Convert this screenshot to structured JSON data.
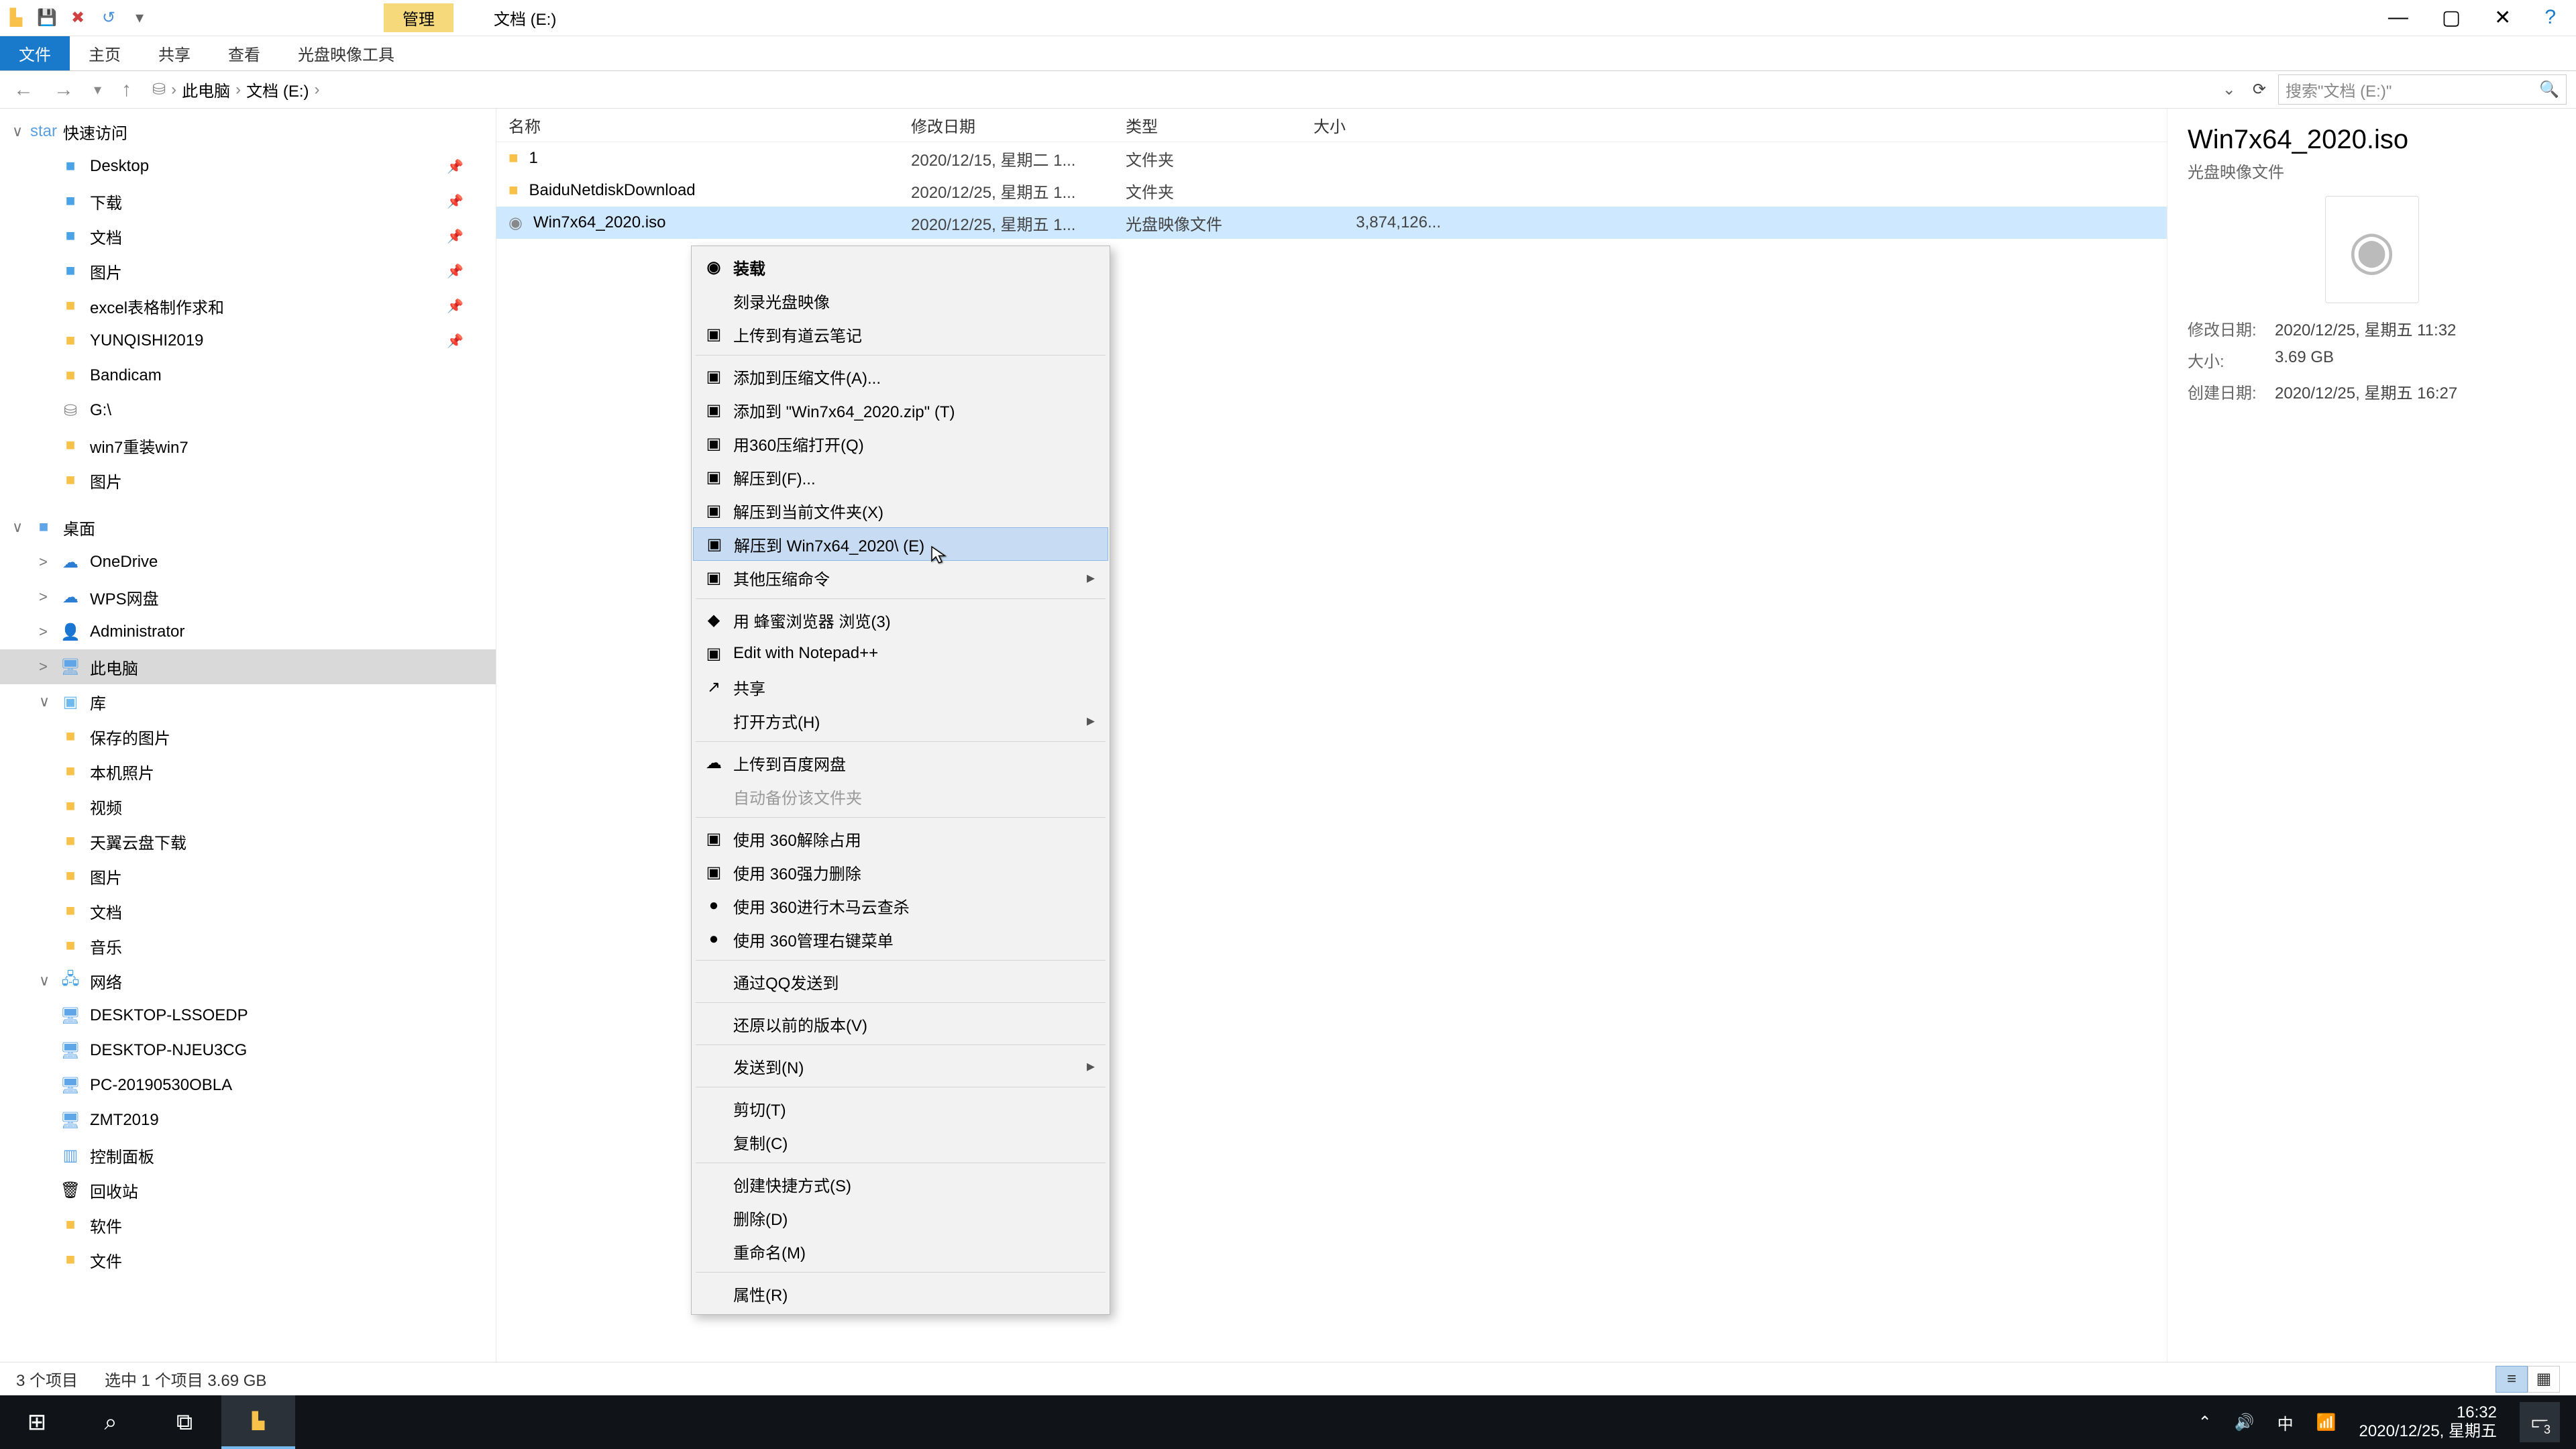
{
  "qat_icons": [
    "folder",
    "disk",
    "delete",
    "undo",
    "dropdown"
  ],
  "context_tab": "管理",
  "window_title": "文档 (E:)",
  "ribbon": {
    "file": "文件",
    "tabs": [
      "主页",
      "共享",
      "查看",
      "光盘映像工具"
    ]
  },
  "nav_buttons": {
    "back": "←",
    "fwd": "→",
    "up": "↑"
  },
  "breadcrumb": [
    "此电脑",
    "文档 (E:)"
  ],
  "search_placeholder": "搜索\"文档 (E:)\"",
  "columns": {
    "name": "名称",
    "date": "修改日期",
    "type": "类型",
    "size": "大小"
  },
  "tree": [
    {
      "label": "快速访问",
      "depth": 1,
      "icon": "star",
      "color": "star",
      "chev": "∨"
    },
    {
      "label": "Desktop",
      "depth": 2,
      "icon": "■",
      "color": "folder-b",
      "pin": true
    },
    {
      "label": "下载",
      "depth": 2,
      "icon": "■",
      "color": "folder-b",
      "pin": true
    },
    {
      "label": "文档",
      "depth": 2,
      "icon": "■",
      "color": "folder-b",
      "pin": true
    },
    {
      "label": "图片",
      "depth": 2,
      "icon": "■",
      "color": "folder-b",
      "pin": true
    },
    {
      "label": "excel表格制作求和",
      "depth": 2,
      "icon": "■",
      "color": "folder-y",
      "pin": true
    },
    {
      "label": "YUNQISHI2019",
      "depth": 2,
      "icon": "■",
      "color": "folder-y",
      "pin": true
    },
    {
      "label": "Bandicam",
      "depth": 2,
      "icon": "■",
      "color": "folder-y"
    },
    {
      "label": "G:\\",
      "depth": 2,
      "icon": "⛁",
      "color": "disk"
    },
    {
      "label": "win7重装win7",
      "depth": 2,
      "icon": "■",
      "color": "folder-y"
    },
    {
      "label": "图片",
      "depth": 2,
      "icon": "■",
      "color": "folder-y"
    },
    {
      "label": "桌面",
      "depth": 1,
      "icon": "■",
      "color": "mon",
      "chev": "∨",
      "spacer": true
    },
    {
      "label": "OneDrive",
      "depth": 2,
      "icon": "☁",
      "color": "cloud",
      "chev": ">"
    },
    {
      "label": "WPS网盘",
      "depth": 2,
      "icon": "☁",
      "color": "cloud",
      "chev": ">"
    },
    {
      "label": "Administrator",
      "depth": 2,
      "icon": "👤",
      "color": "",
      "chev": ">"
    },
    {
      "label": "此电脑",
      "depth": 2,
      "icon": "🖥",
      "color": "mon",
      "chev": ">",
      "sel": true
    },
    {
      "label": "库",
      "depth": 2,
      "icon": "▣",
      "color": "lib",
      "chev": "∨"
    },
    {
      "label": "保存的图片",
      "depth": 3,
      "icon": "■",
      "color": "folder-y"
    },
    {
      "label": "本机照片",
      "depth": 3,
      "icon": "■",
      "color": "folder-y"
    },
    {
      "label": "视频",
      "depth": 3,
      "icon": "■",
      "color": "folder-y"
    },
    {
      "label": "天翼云盘下载",
      "depth": 3,
      "icon": "■",
      "color": "folder-y"
    },
    {
      "label": "图片",
      "depth": 3,
      "icon": "■",
      "color": "folder-y"
    },
    {
      "label": "文档",
      "depth": 3,
      "icon": "■",
      "color": "folder-y"
    },
    {
      "label": "音乐",
      "depth": 3,
      "icon": "■",
      "color": "folder-y"
    },
    {
      "label": "网络",
      "depth": 2,
      "icon": "🖧",
      "color": "net",
      "chev": "∨"
    },
    {
      "label": "DESKTOP-LSSOEDP",
      "depth": 3,
      "icon": "🖥",
      "color": "mon"
    },
    {
      "label": "DESKTOP-NJEU3CG",
      "depth": 3,
      "icon": "🖥",
      "color": "mon"
    },
    {
      "label": "PC-20190530OBLA",
      "depth": 3,
      "icon": "🖥",
      "color": "mon"
    },
    {
      "label": "ZMT2019",
      "depth": 3,
      "icon": "🖥",
      "color": "mon"
    },
    {
      "label": "控制面板",
      "depth": 2,
      "icon": "▥",
      "color": "mon"
    },
    {
      "label": "回收站",
      "depth": 2,
      "icon": "🗑",
      "color": ""
    },
    {
      "label": "软件",
      "depth": 2,
      "icon": "■",
      "color": "folder-y"
    },
    {
      "label": "文件",
      "depth": 2,
      "icon": "■",
      "color": "folder-y"
    }
  ],
  "rows": [
    {
      "name": "1",
      "date": "2020/12/15, 星期二 1...",
      "type": "文件夹",
      "size": "",
      "icon": "■",
      "color": "folder-y"
    },
    {
      "name": "BaiduNetdiskDownload",
      "date": "2020/12/25, 星期五 1...",
      "type": "文件夹",
      "size": "",
      "icon": "■",
      "color": "folder-y"
    },
    {
      "name": "Win7x64_2020.iso",
      "date": "2020/12/25, 星期五 1...",
      "type": "光盘映像文件",
      "size": "3,874,126...",
      "icon": "◉",
      "color": "disk",
      "sel": true
    }
  ],
  "details": {
    "title": "Win7x64_2020.iso",
    "subtitle": "光盘映像文件",
    "meta": [
      {
        "k": "修改日期:",
        "v": "2020/12/25, 星期五 11:32"
      },
      {
        "k": "大小:",
        "v": "3.69 GB"
      },
      {
        "k": "创建日期:",
        "v": "2020/12/25, 星期五 16:27"
      }
    ]
  },
  "context_menu": [
    {
      "label": "装载",
      "icon": "◉",
      "bold": true
    },
    {
      "label": "刻录光盘映像"
    },
    {
      "label": "上传到有道云笔记",
      "icon": "▣"
    },
    {
      "sep": true
    },
    {
      "label": "添加到压缩文件(A)...",
      "icon": "▣"
    },
    {
      "label": "添加到 \"Win7x64_2020.zip\" (T)",
      "icon": "▣"
    },
    {
      "label": "用360压缩打开(Q)",
      "icon": "▣"
    },
    {
      "label": "解压到(F)...",
      "icon": "▣"
    },
    {
      "label": "解压到当前文件夹(X)",
      "icon": "▣"
    },
    {
      "label": "解压到 Win7x64_2020\\ (E)",
      "icon": "▣",
      "hov": true
    },
    {
      "label": "其他压缩命令",
      "icon": "▣",
      "sub": true
    },
    {
      "sep": true
    },
    {
      "label": "用 蜂蜜浏览器 浏览(3)",
      "icon": "◆"
    },
    {
      "label": "Edit with Notepad++",
      "icon": "▣"
    },
    {
      "label": "共享",
      "icon": "↗"
    },
    {
      "label": "打开方式(H)",
      "sub": true
    },
    {
      "sep": true
    },
    {
      "label": "上传到百度网盘",
      "icon": "☁"
    },
    {
      "label": "自动备份该文件夹",
      "dis": true
    },
    {
      "sep": true
    },
    {
      "label": "使用 360解除占用",
      "icon": "▣"
    },
    {
      "label": "使用 360强力删除",
      "icon": "▣"
    },
    {
      "label": "使用 360进行木马云查杀",
      "icon": "●"
    },
    {
      "label": "使用 360管理右键菜单",
      "icon": "●"
    },
    {
      "sep": true
    },
    {
      "label": "通过QQ发送到"
    },
    {
      "sep": true
    },
    {
      "label": "还原以前的版本(V)"
    },
    {
      "sep": true
    },
    {
      "label": "发送到(N)",
      "sub": true
    },
    {
      "sep": true
    },
    {
      "label": "剪切(T)"
    },
    {
      "label": "复制(C)"
    },
    {
      "sep": true
    },
    {
      "label": "创建快捷方式(S)"
    },
    {
      "label": "删除(D)"
    },
    {
      "label": "重命名(M)"
    },
    {
      "sep": true
    },
    {
      "label": "属性(R)"
    }
  ],
  "status": {
    "count": "3 个项目",
    "sel": "选中 1 个项目  3.69 GB"
  },
  "taskbar": {
    "time": "16:32",
    "date": "2020/12/25, 星期五",
    "ime": "中",
    "badge": "3"
  }
}
